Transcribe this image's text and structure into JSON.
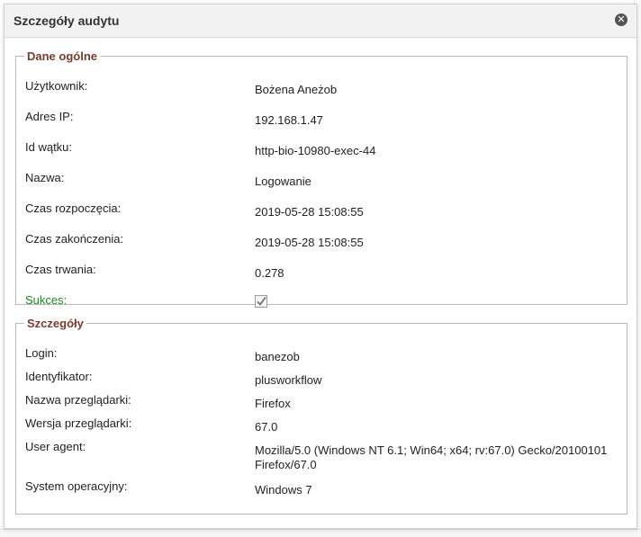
{
  "dialog": {
    "title": "Szczegóły audytu",
    "close_icon": "close-circle-icon"
  },
  "general": {
    "legend": "Dane ogólne",
    "user_label": "Użytkownik:",
    "user_value": "Bożena Aneżob",
    "ip_label": "Adres IP:",
    "ip_value": "192.168.1.47",
    "thread_label": "Id wątku:",
    "thread_value": "http-bio-10980-exec-44",
    "name_label": "Nazwa:",
    "name_value": "Logowanie",
    "start_label": "Czas rozpoczęcia:",
    "start_value": "2019-05-28 15:08:55",
    "end_label": "Czas zakończenia:",
    "end_value": "2019-05-28 15:08:55",
    "duration_label": "Czas trwania:",
    "duration_value": "0.278",
    "success_label": "Sukces:",
    "success_checked": true,
    "success_color": "#1a8a1a"
  },
  "details": {
    "legend": "Szczegóły",
    "login_label": "Login:",
    "login_value": "banezob",
    "identifier_label": "Identyfikator:",
    "identifier_value": "plusworkflow",
    "browser_label": "Nazwa przeglądarki:",
    "browser_value": "Firefox",
    "browser_version_label": "Wersja przeglądarki:",
    "browser_version_value": "67.0",
    "user_agent_label": "User agent:",
    "user_agent_value": "Mozilla/5.0 (Windows NT 6.1; Win64; x64; rv:67.0) Gecko/20100101 Firefox/67.0",
    "os_label": "System operacyjny:",
    "os_value": "Windows 7"
  },
  "colors": {
    "legend": "#7a3b2e",
    "header_bg": "#f2f2f2"
  }
}
